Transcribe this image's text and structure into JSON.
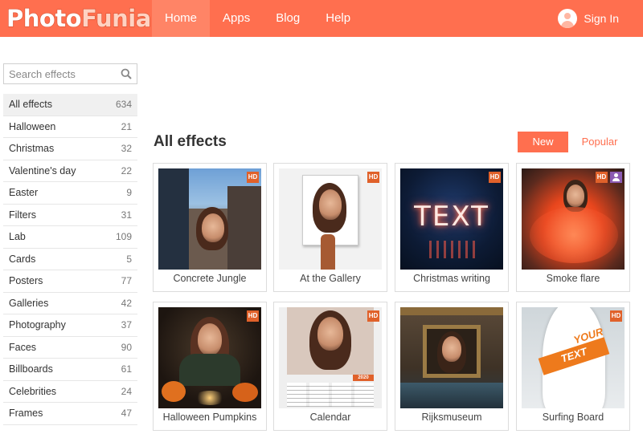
{
  "header": {
    "logo_part1": "Photo",
    "logo_part2": "Funia",
    "nav": [
      "Home",
      "Apps",
      "Blog",
      "Help"
    ],
    "sign_in": "Sign In"
  },
  "sidebar": {
    "search_placeholder": "Search effects",
    "categories": [
      {
        "label": "All effects",
        "count": "634"
      },
      {
        "label": "Halloween",
        "count": "21"
      },
      {
        "label": "Christmas",
        "count": "32"
      },
      {
        "label": "Valentine's day",
        "count": "22"
      },
      {
        "label": "Easter",
        "count": "9"
      },
      {
        "label": "Filters",
        "count": "31"
      },
      {
        "label": "Lab",
        "count": "109"
      },
      {
        "label": "Cards",
        "count": "5"
      },
      {
        "label": "Posters",
        "count": "77"
      },
      {
        "label": "Galleries",
        "count": "42"
      },
      {
        "label": "Photography",
        "count": "37"
      },
      {
        "label": "Faces",
        "count": "90"
      },
      {
        "label": "Billboards",
        "count": "61"
      },
      {
        "label": "Celebrities",
        "count": "24"
      },
      {
        "label": "Frames",
        "count": "47"
      }
    ]
  },
  "main": {
    "title": "All effects",
    "sort_new": "New",
    "sort_popular": "Popular",
    "hd_label": "HD",
    "cards": [
      {
        "caption": "Concrete Jungle"
      },
      {
        "caption": "At the Gallery"
      },
      {
        "caption": "Christmas writing",
        "thumb_text": "TEXT"
      },
      {
        "caption": "Smoke flare"
      },
      {
        "caption": "Halloween Pumpkins"
      },
      {
        "caption": "Calendar",
        "year": "2020"
      },
      {
        "caption": "Rijksmuseum"
      },
      {
        "caption": "Surfing Board",
        "board_text_1": "YOUR",
        "board_text_2": "TEXT"
      }
    ]
  },
  "colors": {
    "brand": "#ff6f4f",
    "hd_badge": "#e0612a"
  }
}
